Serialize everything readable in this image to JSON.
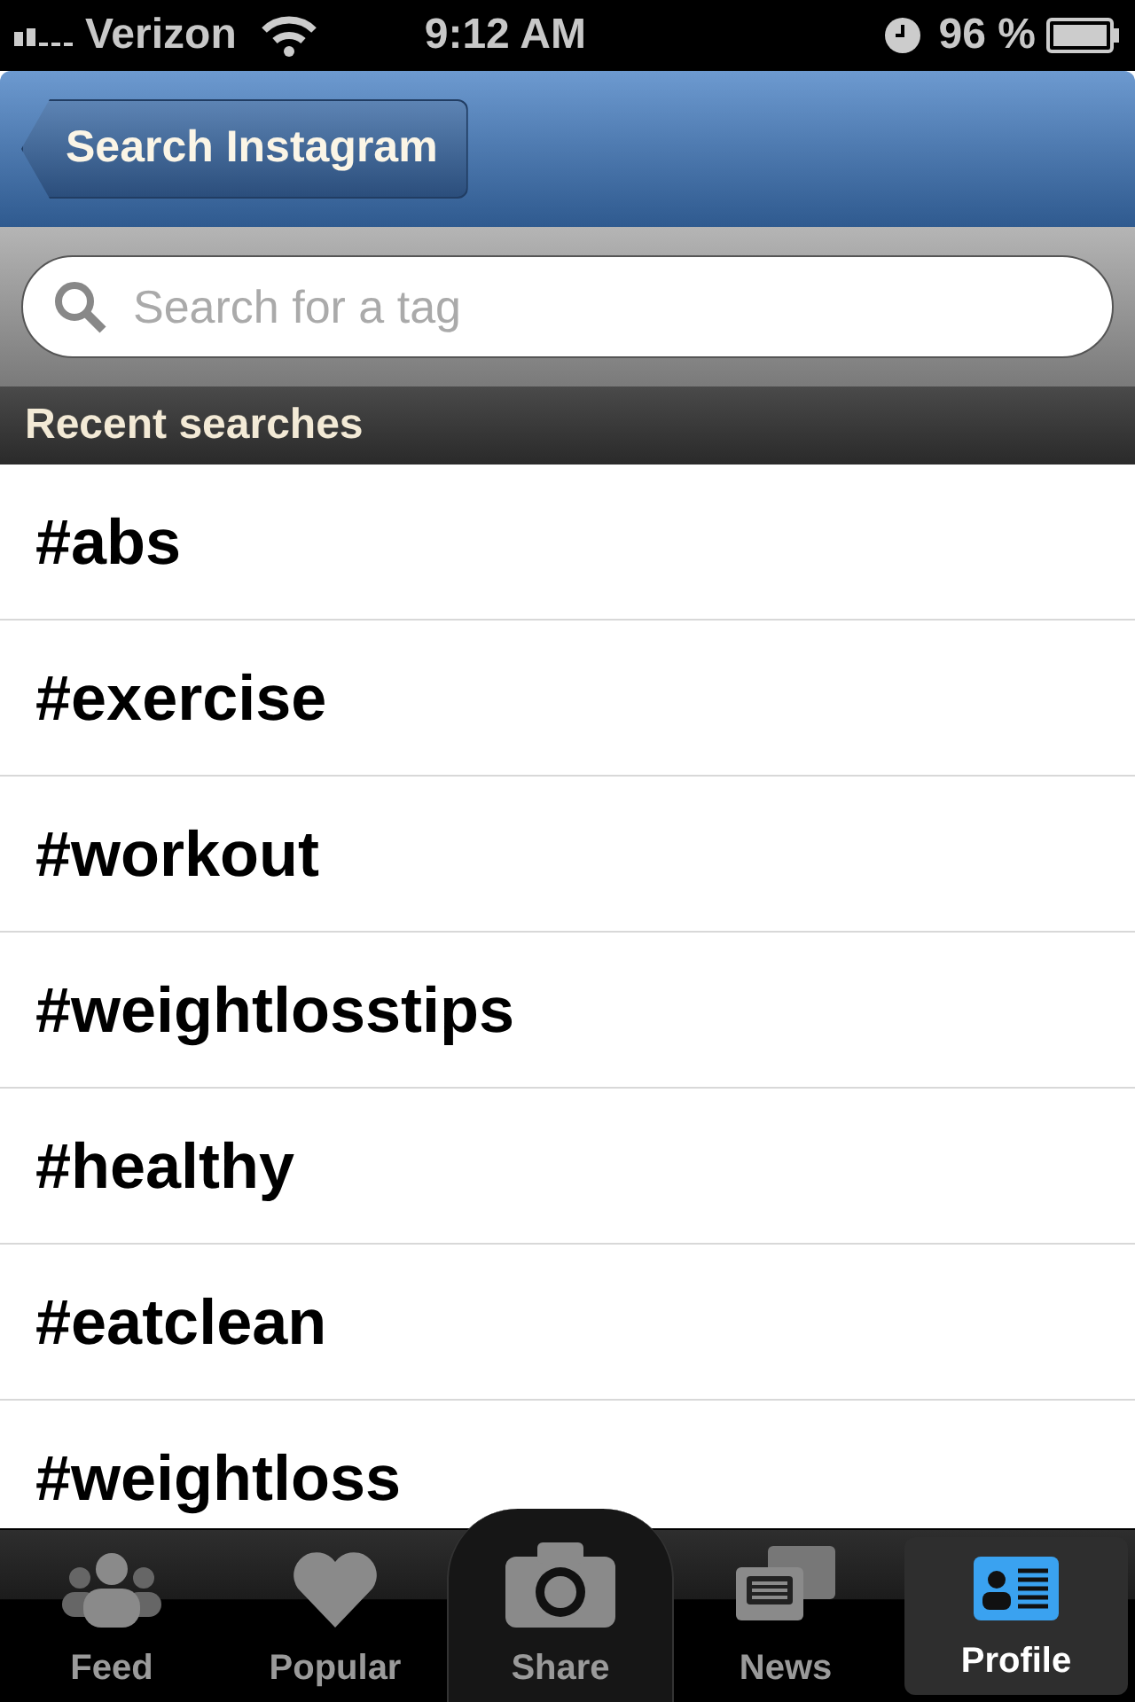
{
  "status_bar": {
    "carrier": "Verizon",
    "time": "9:12 AM",
    "battery": "96 %"
  },
  "nav": {
    "back": "Search Instagram"
  },
  "search": {
    "placeholder": "Search for a tag"
  },
  "section": {
    "title": "Recent searches"
  },
  "recent": [
    "#abs",
    "#exercise",
    "#workout",
    "#weightlosstips",
    "#healthy",
    "#eatclean",
    "#weightloss"
  ],
  "tabs": [
    {
      "label": "Feed",
      "kind": "feed",
      "selected": false
    },
    {
      "label": "Popular",
      "kind": "popular",
      "selected": false
    },
    {
      "label": "Share",
      "kind": "share",
      "selected": false
    },
    {
      "label": "News",
      "kind": "news",
      "selected": false
    },
    {
      "label": "Profile",
      "kind": "profile",
      "selected": true
    }
  ]
}
